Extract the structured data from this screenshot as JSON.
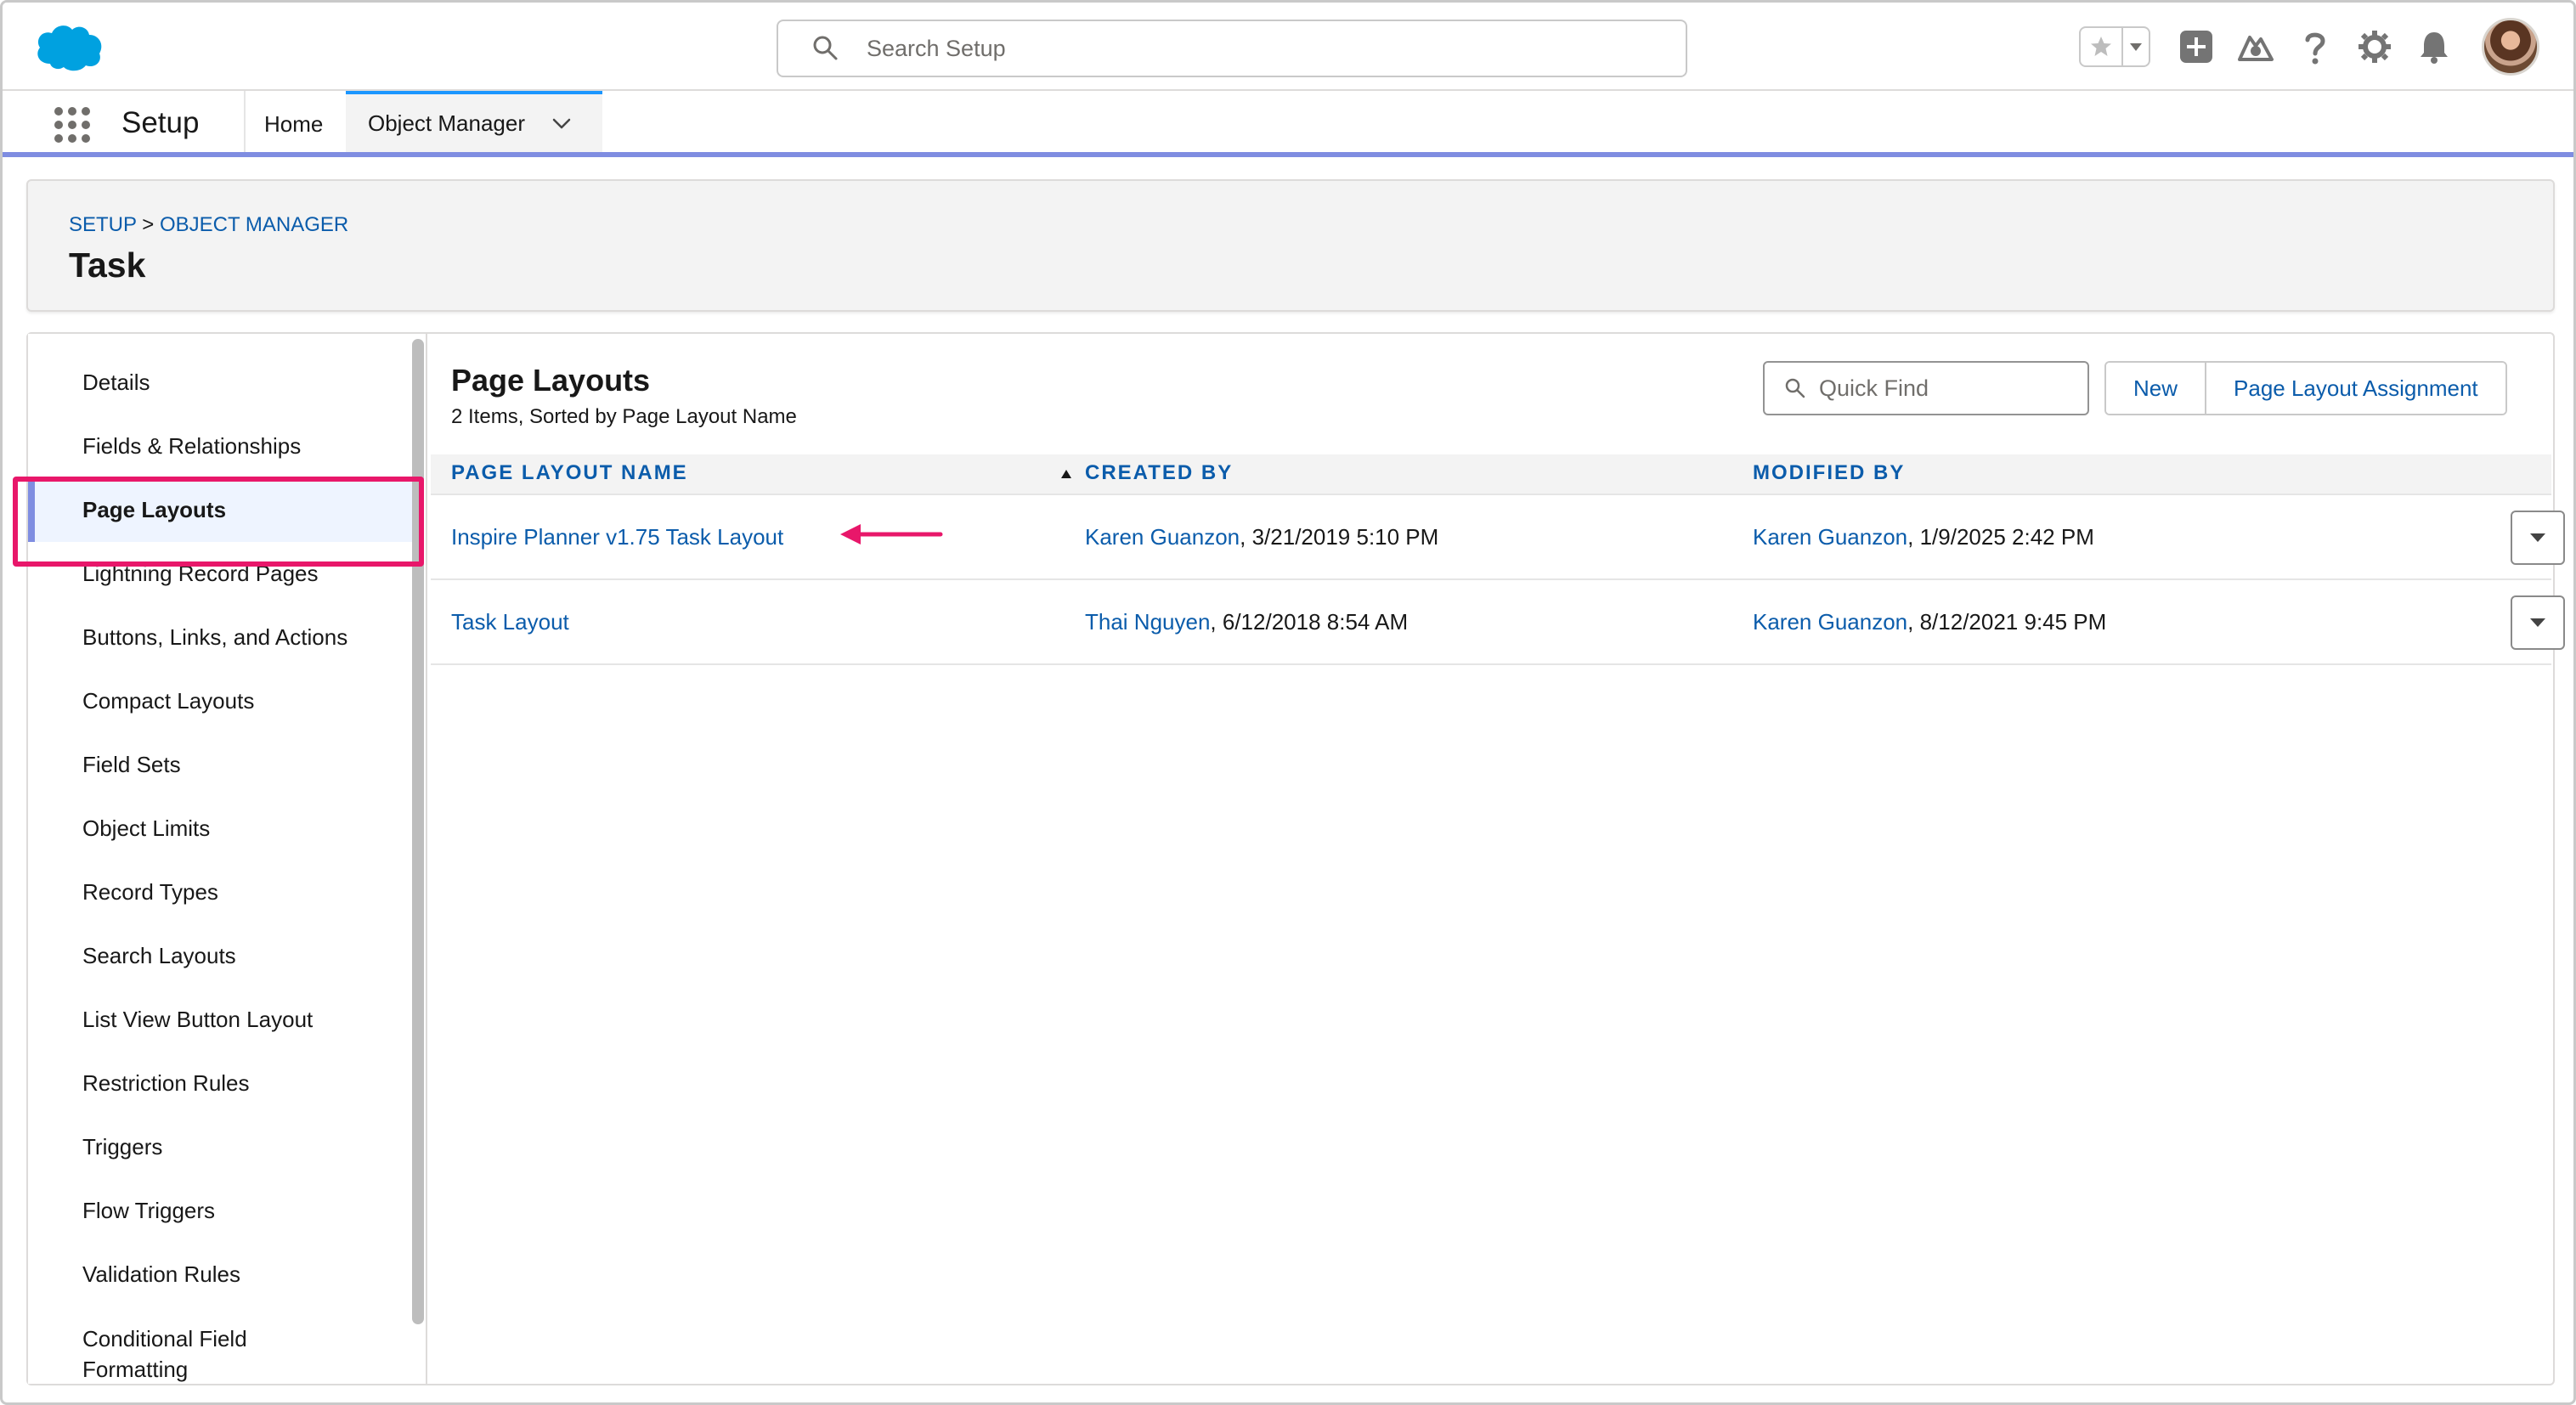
{
  "header": {
    "search_placeholder": "Search Setup"
  },
  "app_nav": {
    "app_name": "Setup",
    "tabs": [
      {
        "label": "Home"
      },
      {
        "label": "Object Manager"
      }
    ]
  },
  "page_header": {
    "breadcrumb": [
      "SETUP",
      ">",
      "OBJECT MANAGER"
    ],
    "title": "Task"
  },
  "sidebar": {
    "items": [
      {
        "label": "Details"
      },
      {
        "label": "Fields & Relationships"
      },
      {
        "label": "Page Layouts"
      },
      {
        "label": "Lightning Record Pages"
      },
      {
        "label": "Buttons, Links, and Actions"
      },
      {
        "label": "Compact Layouts"
      },
      {
        "label": "Field Sets"
      },
      {
        "label": "Object Limits"
      },
      {
        "label": "Record Types"
      },
      {
        "label": "Search Layouts"
      },
      {
        "label": "List View Button Layout"
      },
      {
        "label": "Restriction Rules"
      },
      {
        "label": "Triggers"
      },
      {
        "label": "Flow Triggers"
      },
      {
        "label": "Validation Rules"
      },
      {
        "label": "Conditional Field Formatting"
      }
    ],
    "active": "Page Layouts"
  },
  "main": {
    "title": "Page Layouts",
    "subtitle": "2 Items, Sorted by Page Layout Name",
    "quick_find_placeholder": "Quick Find",
    "buttons": {
      "new": "New",
      "assignment": "Page Layout Assignment"
    },
    "columns": [
      "PAGE LAYOUT NAME",
      "CREATED BY",
      "MODIFIED BY"
    ],
    "rows": [
      {
        "name": "Inspire Planner v1.75 Task Layout",
        "created_by": "Karen Guanzon",
        "created_on": ", 3/21/2019 5:10 PM",
        "modified_by": "Karen Guanzon",
        "modified_on": ", 1/9/2025 2:42 PM"
      },
      {
        "name": "Task Layout",
        "created_by": "Thai Nguyen",
        "created_on": ", 6/12/2018 8:54 AM",
        "modified_by": "Karen Guanzon",
        "modified_on": ", 8/12/2021 9:45 PM"
      }
    ]
  },
  "colors": {
    "link": "#0b5cab",
    "brand_cloud": "#00a1e0",
    "active_nav_bar": "#7f8de1",
    "annotation": "#e8176a"
  },
  "icons": [
    "salesforce-cloud-logo",
    "search-icon",
    "star-icon",
    "chevron-down-icon",
    "plus-icon",
    "trailhead-icon",
    "help-icon",
    "gear-icon",
    "bell-icon",
    "waffle-icon",
    "sort-ascending-icon",
    "row-menu-icon",
    "annotation-arrow"
  ]
}
